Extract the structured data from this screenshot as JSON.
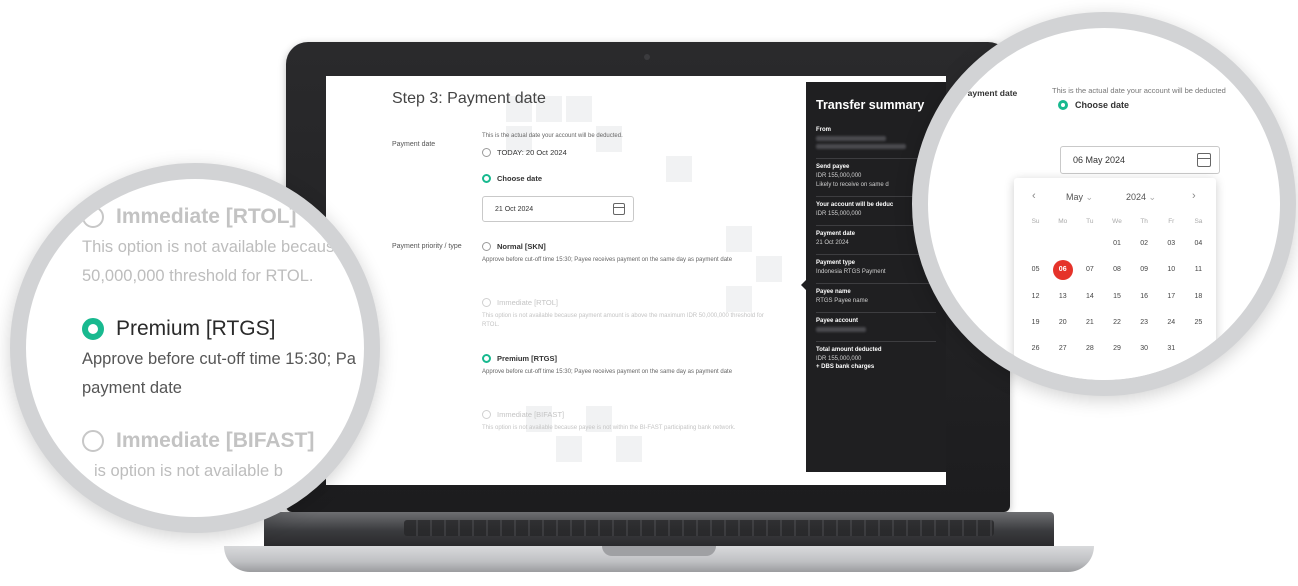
{
  "screen": {
    "step_title": "Step 3: Payment date",
    "payment_date": {
      "label": "Payment date",
      "note": "This is the actual date your account will be deducted.",
      "option_today": "TODAY: 20 Oct 2024",
      "option_choose": "Choose date",
      "date_value": "21 Oct 2024"
    },
    "priority": {
      "label": "Payment priority / type",
      "options": [
        {
          "label": "Normal [SKN]",
          "note": "Approve before cut-off time 15:30; Payee receives payment on the same day as payment date",
          "state": "off"
        },
        {
          "label": "Immediate [RTOL]",
          "note": "This option is not available because payment amount is above the maximum IDR 50,000,000 threshold for RTOL.",
          "state": "disabled"
        },
        {
          "label": "Premium [RTGS]",
          "note": "Approve before cut-off time 15:30; Payee receives payment on the same day as payment date",
          "state": "on"
        },
        {
          "label": "Immediate [BIFAST]",
          "note": "This option is not available because payee is not within the BI-FAST participating bank network.",
          "state": "disabled"
        }
      ]
    },
    "summary": {
      "title": "Transfer summary",
      "blocks": [
        {
          "head": "From",
          "lines": []
        },
        {
          "head": "Send payee",
          "lines": [
            "IDR 155,000,000",
            "Likely to receive on same d"
          ]
        },
        {
          "head": "Your account will be deduc",
          "lines": [
            "IDR 155,000,000"
          ]
        },
        {
          "head": "Payment date",
          "lines": [
            "21 Oct 2024"
          ]
        },
        {
          "head": "Payment type",
          "lines": [
            "Indonesia RTGS Payment"
          ]
        },
        {
          "head": "Payee name",
          "lines": [
            "RTGS Payee name"
          ]
        },
        {
          "head": "Payee account",
          "lines": []
        },
        {
          "head": "Total amount deducted",
          "lines": [
            "IDR 155,000,000"
          ],
          "extra": "+ DBS bank charges"
        }
      ]
    }
  },
  "magnifier_left": {
    "rtol_label": "Immediate [RTOL]",
    "rtol_note_1": "This option is not available becaus",
    "rtol_note_2": "50,000,000 threshold for RTOL.",
    "rtgs_label": "Premium [RTGS]",
    "rtgs_note_1": "Approve before cut-off time 15:30; Pa",
    "rtgs_note_2": "payment date",
    "bifast_label": "Immediate [BIFAST]",
    "bifast_note": "is option is not available b"
  },
  "magnifier_right": {
    "label": "Payment date",
    "note": "This is the actual date your account will be deducted",
    "option_choose": "Choose date",
    "date_value": "06 May 2024",
    "datepicker": {
      "month": "May",
      "year": "2024",
      "weekdays": [
        "Su",
        "Mo",
        "Tu",
        "We",
        "Th",
        "Fr",
        "Sa"
      ],
      "days": [
        "",
        "",
        "",
        "01",
        "02",
        "03",
        "04",
        "05",
        "06",
        "07",
        "08",
        "09",
        "10",
        "11",
        "12",
        "13",
        "14",
        "15",
        "16",
        "17",
        "18",
        "19",
        "20",
        "21",
        "22",
        "23",
        "24",
        "25",
        "26",
        "27",
        "28",
        "29",
        "30",
        "31",
        ""
      ],
      "selected": "06"
    }
  },
  "colors": {
    "accent": "#18b98f",
    "selected_day": "#e5332a",
    "summary_bg": "#1f1f21"
  }
}
